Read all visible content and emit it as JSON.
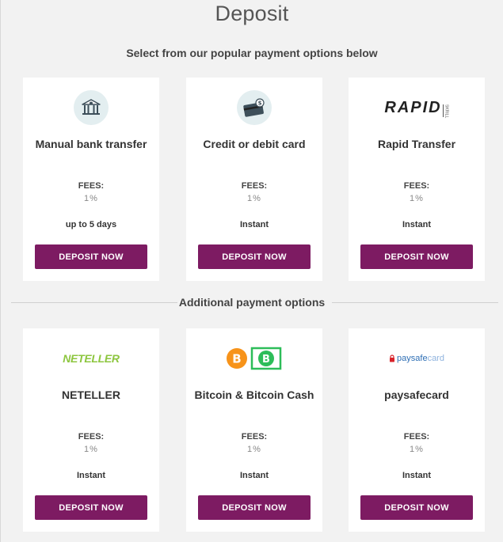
{
  "page": {
    "title": "Deposit",
    "subtitle": "Select from our popular payment options below",
    "additional_heading": "Additional payment options"
  },
  "colors": {
    "button_bg": "#7d1b62",
    "background": "#f2f2f2",
    "neteller_green": "#8dc63f",
    "bitcoin_orange": "#f7931a",
    "bitcoin_cash_green": "#2dbd59",
    "paysafe_red": "#d8232a",
    "paysafe_blue": "#2f6fb5"
  },
  "popular_methods": [
    {
      "name": "Manual bank transfer",
      "icon": "bank-icon",
      "fees_label": "FEES:",
      "fees": "1%",
      "time": "up to 5 days",
      "button": "DEPOSIT NOW"
    },
    {
      "name": "Credit or debit card",
      "icon": "credit-card-icon",
      "fees_label": "FEES:",
      "fees": "1%",
      "time": "Instant",
      "button": "DEPOSIT NOW"
    },
    {
      "name": "Rapid Transfer",
      "icon": "rapid-logo",
      "logo_text": "RAPID",
      "logo_sub": "SKRILL",
      "fees_label": "FEES:",
      "fees": "1%",
      "time": "Instant",
      "button": "DEPOSIT NOW"
    }
  ],
  "additional_methods": [
    {
      "name": "NETELLER",
      "icon": "neteller-logo",
      "logo_text": "NETELLER",
      "fees_label": "FEES:",
      "fees": "1%",
      "time": "Instant",
      "button": "DEPOSIT NOW"
    },
    {
      "name": "Bitcoin & Bitcoin Cash",
      "icon": "bitcoin-icon",
      "fees_label": "FEES:",
      "fees": "1%",
      "time": "Instant",
      "button": "DEPOSIT NOW"
    },
    {
      "name": "paysafecard",
      "icon": "paysafecard-logo",
      "logo_text_a": "paysafe",
      "logo_text_b": "card",
      "fees_label": "FEES:",
      "fees": "1%",
      "time": "Instant",
      "button": "DEPOSIT NOW"
    }
  ]
}
